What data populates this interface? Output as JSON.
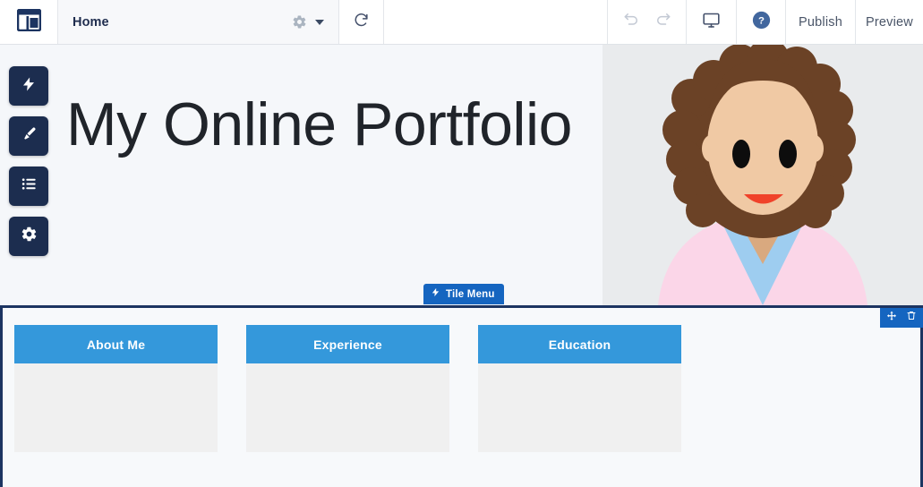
{
  "toolbar": {
    "logo_icon": "layout-template-icon",
    "page_name": "Home",
    "page_settings_icon": "gear-icon",
    "page_dropdown_icon": "chevron-down-icon",
    "refresh_icon": "refresh-icon",
    "undo_icon": "undo-arrow-icon",
    "redo_icon": "redo-arrow-icon",
    "device_icon": "desktop-monitor-icon",
    "help_icon": "help-question-circle-icon",
    "publish_label": "Publish",
    "preview_label": "Preview"
  },
  "sidebar": {
    "items": [
      {
        "icon": "lightning-bolt-icon",
        "name": "add-element"
      },
      {
        "icon": "paintbrush-icon",
        "name": "design"
      },
      {
        "icon": "list-icon",
        "name": "pages-list"
      },
      {
        "icon": "gear-icon",
        "name": "settings"
      }
    ]
  },
  "hero": {
    "title": "My Online Portfolio",
    "bg_left_color": "#f5f7fa",
    "bg_right_color": "#e9ebed",
    "avatar": {
      "name": "woman-avatar-illustration",
      "hair_color": "#6b4226",
      "skin_color": "#f0c9a4",
      "shirt_color": "#fbd6e8",
      "collar_color": "#9ecdf0",
      "mouth_color": "#f0422a",
      "eye_color": "#0d0d0d"
    }
  },
  "tile_badge": {
    "icon": "lightning-bolt-icon",
    "label": "Tile Menu",
    "color": "#1565c0"
  },
  "section": {
    "accent_color": "#1c3461",
    "tools": [
      {
        "icon": "move-arrows-icon",
        "name": "move-section"
      },
      {
        "icon": "trash-icon",
        "name": "delete-section"
      }
    ],
    "tiles": [
      {
        "label": "About Me",
        "color": "#3498db"
      },
      {
        "label": "Experience",
        "color": "#3498db"
      },
      {
        "label": "Education",
        "color": "#3498db"
      }
    ]
  }
}
